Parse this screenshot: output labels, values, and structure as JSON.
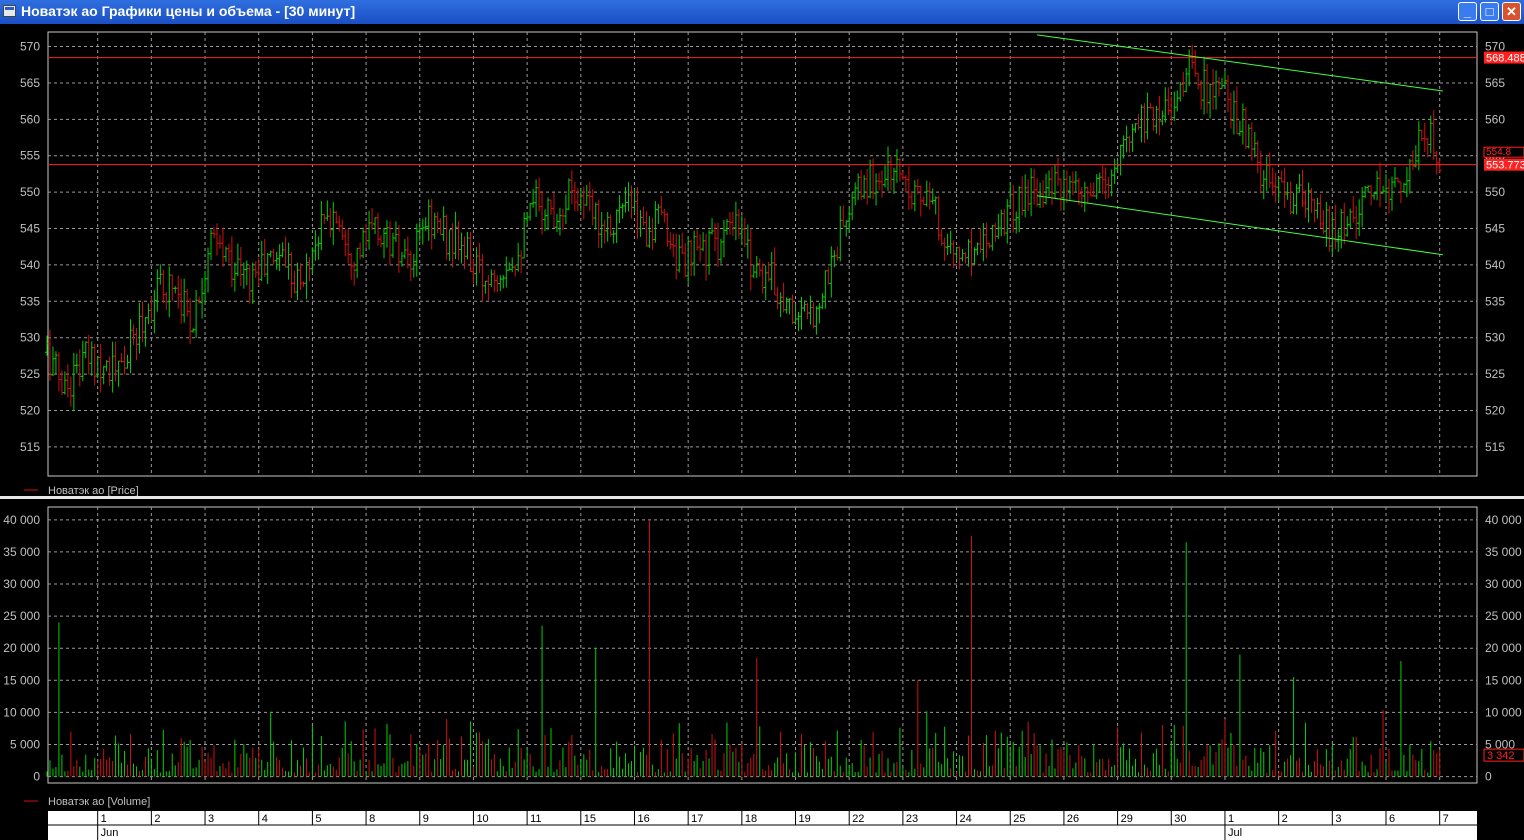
{
  "window": {
    "title": "Новатэк ао Графики цены и объема - [30 минут]",
    "buttons": [
      "_",
      "□",
      "✕"
    ],
    "icon": "chart-window-icon"
  },
  "colors": {
    "up": "#00d000",
    "down": "#d01010",
    "grid": "#9a9a9a",
    "trend": "#40ff40",
    "hline": "#ff2020",
    "bg": "#000000"
  },
  "chart_data": [
    {
      "type": "candlestick",
      "legend": "Новатэк ао [Price]",
      "ylim": [
        511,
        572
      ],
      "yticks": [
        515,
        520,
        525,
        530,
        535,
        540,
        545,
        550,
        555,
        560,
        565,
        570
      ],
      "hlines": [
        {
          "value": 568.488,
          "label": "568.488"
        },
        {
          "value": 553.773,
          "label": "553.773"
        }
      ],
      "last_price": {
        "value": 554.8,
        "label": "554.8"
      },
      "trendlines": [
        {
          "from": [
            "26 Jun",
            571.6
          ],
          "to": [
            "7 Jul",
            563.9
          ]
        },
        {
          "from": [
            "26 Jun",
            549.5
          ],
          "to": [
            "7 Jul",
            541.4
          ]
        }
      ],
      "series": [
        {
          "session_closes": [
            [
              528,
              523,
              527
            ],
            [
              527,
              525,
              531
            ],
            [
              536,
              538,
              532
            ],
            [
              543,
              541,
              538
            ],
            [
              540,
              542,
              537
            ],
            [
              545,
              547,
              541
            ],
            [
              545,
              543,
              539
            ],
            [
              547,
              544,
              542
            ],
            [
              538,
              540,
              542
            ],
            [
              549,
              547,
              551
            ],
            [
              547,
              546,
              548
            ],
            [
              545,
              546,
              540
            ],
            [
              542,
              543,
              545
            ],
            [
              540,
              538,
              534
            ],
            [
              532,
              538,
              546
            ],
            [
              551,
              552,
              553
            ],
            [
              550,
              547,
              541
            ],
            [
              542,
              545,
              547
            ],
            [
              550,
              551,
              550
            ],
            [
              549,
              550,
              553
            ],
            [
              560,
              561,
              562
            ],
            [
              567,
              564,
              563
            ],
            [
              559,
              552,
              550
            ],
            [
              549,
              547,
              544
            ],
            [
              547,
              549,
              551
            ],
            [
              552,
              558,
              555
            ]
          ]
        }
      ]
    },
    {
      "type": "bar",
      "legend": "Новатэк ао [Volume]",
      "ylim": [
        -1000,
        42000
      ],
      "yticks": [
        0,
        5000,
        10000,
        15000,
        20000,
        25000,
        30000,
        35000,
        40000
      ],
      "ytick_labels": [
        "0",
        "5 000",
        "10 000",
        "15 000",
        "20 000",
        "25 000",
        "30 000",
        "35 000",
        "40 000"
      ],
      "last_value": {
        "value": 3342,
        "label": "3 342"
      },
      "spikes": [
        {
          "session": "1 Jun",
          "value": 24000
        },
        {
          "session": "15 Jun",
          "value": 23500
        },
        {
          "session": "16 Jun",
          "value": 20000
        },
        {
          "session": "17 Jun",
          "value": 40000
        },
        {
          "session": "19 Jun",
          "value": 18500
        },
        {
          "session": "24 Jun",
          "value": 15000
        },
        {
          "session": "25 Jun",
          "value": 37500
        },
        {
          "session": "1 Jul",
          "value": 36500
        },
        {
          "session": "2 Jul",
          "value": 19000
        },
        {
          "session": "3 Jul",
          "value": 15500
        },
        {
          "session": "7 Jul",
          "value": 18000
        }
      ]
    }
  ],
  "xaxis": {
    "sessions": [
      "1",
      "2",
      "3",
      "4",
      "5",
      "8",
      "9",
      "10",
      "11",
      "15",
      "16",
      "17",
      "18",
      "19",
      "22",
      "23",
      "24",
      "25",
      "26",
      "29",
      "30",
      "1",
      "2",
      "3",
      "6",
      "7"
    ],
    "months": [
      {
        "label": "Jun",
        "index": 0
      },
      {
        "label": "Jul",
        "index": 21
      }
    ]
  }
}
